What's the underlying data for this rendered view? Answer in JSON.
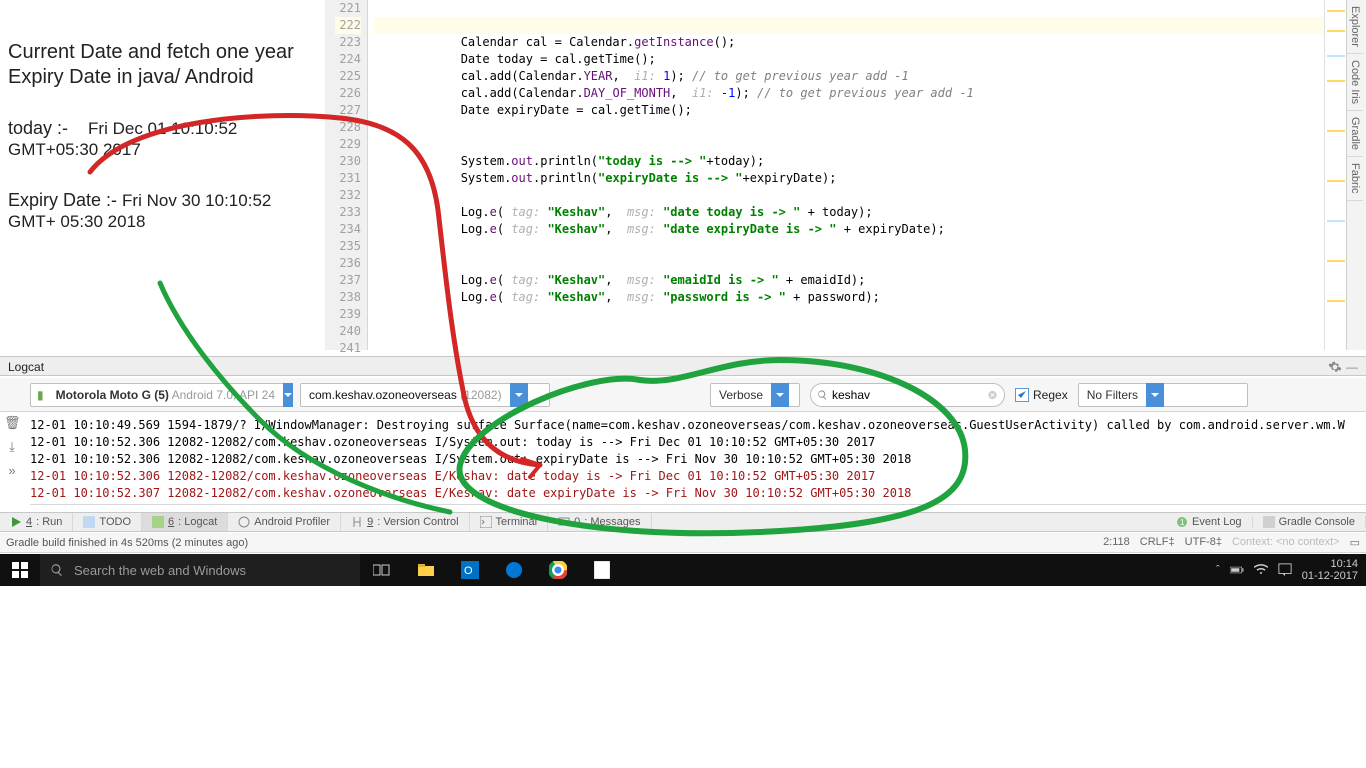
{
  "annotation": {
    "title": "Current Date and fetch one year Expiry Date in java/ Android",
    "today_label": "today :-",
    "today_value": "Fri Dec 01 10:10:52 GMT+05:30 2017",
    "expiry_label": "Expiry Date :- ",
    "expiry_value": "Fri Nov 30 10:10:52 GMT+ 05:30 2018"
  },
  "editor": {
    "first_line": 221,
    "highlight_line": 222,
    "lines": {
      "221": "",
      "222": "",
      "223": {
        "indent": "            ",
        "raw": "Calendar cal = Calendar.getInstance();",
        "segments": [
          {
            "t": "Calendar cal = Calendar",
            "c": "ident"
          },
          {
            "t": ".",
            "c": "dot"
          },
          {
            "t": "getInstance",
            "c": "field"
          },
          {
            "t": "();",
            "c": "ident"
          }
        ]
      },
      "224": {
        "indent": "            ",
        "raw": "Date today = cal.getTime();",
        "segments": [
          {
            "t": "Date today = cal",
            "c": "ident"
          },
          {
            "t": ".",
            "c": "dot"
          },
          {
            "t": "getTime",
            "c": "ident"
          },
          {
            "t": "();",
            "c": "ident"
          }
        ]
      },
      "225": {
        "indent": "            ",
        "raw": "cal.add(Calendar.YEAR,  i1: 1); // to get previous year add -1",
        "segments": [
          {
            "t": "cal",
            "c": "ident"
          },
          {
            "t": ".",
            "c": "dot"
          },
          {
            "t": "add",
            "c": "ident"
          },
          {
            "t": "(Calendar",
            "c": "ident"
          },
          {
            "t": ".",
            "c": "dot"
          },
          {
            "t": "YEAR",
            "c": "field"
          },
          {
            "t": ",  ",
            "c": "ident"
          },
          {
            "t": "i1:",
            "c": "hint"
          },
          {
            "t": " ",
            "c": "ident"
          },
          {
            "t": "1",
            "c": "num"
          },
          {
            "t": "); ",
            "c": "ident"
          },
          {
            "t": "// to get previous year add -1",
            "c": "cmt"
          }
        ]
      },
      "226": {
        "indent": "            ",
        "raw": "cal.add(Calendar.DAY_OF_MONTH,  i1: -1); // to get previous year add -1",
        "segments": [
          {
            "t": "cal",
            "c": "ident"
          },
          {
            "t": ".",
            "c": "dot"
          },
          {
            "t": "add",
            "c": "ident"
          },
          {
            "t": "(Calendar",
            "c": "ident"
          },
          {
            "t": ".",
            "c": "dot"
          },
          {
            "t": "DAY_OF_MONTH",
            "c": "field"
          },
          {
            "t": ",  ",
            "c": "ident"
          },
          {
            "t": "i1:",
            "c": "hint"
          },
          {
            "t": " ",
            "c": "ident"
          },
          {
            "t": "-1",
            "c": "num"
          },
          {
            "t": "); ",
            "c": "ident"
          },
          {
            "t": "// to get previous year add -1",
            "c": "cmt"
          }
        ]
      },
      "227": {
        "indent": "            ",
        "raw": "Date expiryDate = cal.getTime();",
        "segments": [
          {
            "t": "Date expiryDate = cal",
            "c": "ident"
          },
          {
            "t": ".",
            "c": "dot"
          },
          {
            "t": "getTime",
            "c": "ident"
          },
          {
            "t": "();",
            "c": "ident"
          }
        ]
      },
      "228": "",
      "229": "",
      "230": {
        "indent": "            ",
        "raw": "System.out.println(\"today is --> \"+today);",
        "segments": [
          {
            "t": "System",
            "c": "ident"
          },
          {
            "t": ".",
            "c": "dot"
          },
          {
            "t": "out",
            "c": "field"
          },
          {
            "t": ".",
            "c": "dot"
          },
          {
            "t": "println",
            "c": "ident"
          },
          {
            "t": "(",
            "c": "ident"
          },
          {
            "t": "\"today is --> \"",
            "c": "str"
          },
          {
            "t": "+today);",
            "c": "ident"
          }
        ]
      },
      "231": {
        "indent": "            ",
        "raw": "System.out.println(\"expiryDate is --> \"+expiryDate);",
        "segments": [
          {
            "t": "System",
            "c": "ident"
          },
          {
            "t": ".",
            "c": "dot"
          },
          {
            "t": "out",
            "c": "field"
          },
          {
            "t": ".",
            "c": "dot"
          },
          {
            "t": "println",
            "c": "ident"
          },
          {
            "t": "(",
            "c": "ident"
          },
          {
            "t": "\"expiryDate is --> \"",
            "c": "str"
          },
          {
            "t": "+expiryDate);",
            "c": "ident"
          }
        ]
      },
      "232": "",
      "233": {
        "indent": "            ",
        "raw": "Log.e( tag: \"Keshav\",  msg: \"date today is -> \" + today);",
        "segments": [
          {
            "t": "Log",
            "c": "ident"
          },
          {
            "t": ".",
            "c": "dot"
          },
          {
            "t": "e",
            "c": "field"
          },
          {
            "t": "( ",
            "c": "ident"
          },
          {
            "t": "tag:",
            "c": "hint"
          },
          {
            "t": " ",
            "c": "ident"
          },
          {
            "t": "\"Keshav\"",
            "c": "str"
          },
          {
            "t": ",  ",
            "c": "ident"
          },
          {
            "t": "msg:",
            "c": "hint"
          },
          {
            "t": " ",
            "c": "ident"
          },
          {
            "t": "\"date today is -> \"",
            "c": "str"
          },
          {
            "t": " + today);",
            "c": "ident"
          }
        ]
      },
      "234": {
        "indent": "            ",
        "raw": "Log.e( tag: \"Keshav\",  msg: \"date expiryDate is -> \" + expiryDate);",
        "segments": [
          {
            "t": "Log",
            "c": "ident"
          },
          {
            "t": ".",
            "c": "dot"
          },
          {
            "t": "e",
            "c": "field"
          },
          {
            "t": "( ",
            "c": "ident"
          },
          {
            "t": "tag:",
            "c": "hint"
          },
          {
            "t": " ",
            "c": "ident"
          },
          {
            "t": "\"Keshav\"",
            "c": "str"
          },
          {
            "t": ",  ",
            "c": "ident"
          },
          {
            "t": "msg:",
            "c": "hint"
          },
          {
            "t": " ",
            "c": "ident"
          },
          {
            "t": "\"date expiryDate is -> \"",
            "c": "str"
          },
          {
            "t": " + expiryDate);",
            "c": "ident"
          }
        ]
      },
      "235": "",
      "236": "",
      "237": {
        "indent": "            ",
        "raw": "Log.e( tag: \"Keshav\",  msg: \"emaidId is -> \" + emaidId);",
        "segments": [
          {
            "t": "Log",
            "c": "ident"
          },
          {
            "t": ".",
            "c": "dot"
          },
          {
            "t": "e",
            "c": "field"
          },
          {
            "t": "( ",
            "c": "ident"
          },
          {
            "t": "tag:",
            "c": "hint"
          },
          {
            "t": " ",
            "c": "ident"
          },
          {
            "t": "\"Keshav\"",
            "c": "str"
          },
          {
            "t": ",  ",
            "c": "ident"
          },
          {
            "t": "msg:",
            "c": "hint"
          },
          {
            "t": " ",
            "c": "ident"
          },
          {
            "t": "\"emaidId is -> \"",
            "c": "str"
          },
          {
            "t": " + emaidId);",
            "c": "ident"
          }
        ]
      },
      "238": {
        "indent": "            ",
        "raw": "Log.e( tag: \"Keshav\",  msg: \"password is -> \" + password);",
        "segments": [
          {
            "t": "Log",
            "c": "ident"
          },
          {
            "t": ".",
            "c": "dot"
          },
          {
            "t": "e",
            "c": "field"
          },
          {
            "t": "( ",
            "c": "ident"
          },
          {
            "t": "tag:",
            "c": "hint"
          },
          {
            "t": " ",
            "c": "ident"
          },
          {
            "t": "\"Keshav\"",
            "c": "str"
          },
          {
            "t": ",  ",
            "c": "ident"
          },
          {
            "t": "msg:",
            "c": "hint"
          },
          {
            "t": " ",
            "c": "ident"
          },
          {
            "t": "\"password is -> \"",
            "c": "str"
          },
          {
            "t": " + password);",
            "c": "ident"
          }
        ]
      },
      "239": "",
      "240": "",
      "241": ""
    }
  },
  "right_tools": [
    "Explorer",
    "Code Iris",
    "Gradle",
    "Fabric"
  ],
  "logcat": {
    "tab_title": "Logcat",
    "device": {
      "name": "Motorola Moto G (5)",
      "extra": "Android 7.0, API 24"
    },
    "app": {
      "name": "com.keshav.ozoneoverseas",
      "extra": "(12082)"
    },
    "level": "Verbose",
    "search": "keshav",
    "regex_label": "Regex",
    "regex_checked": true,
    "filter": "No Filters",
    "lines": [
      {
        "lvl": "i",
        "t": "12-01 10:10:49.569 1594-1879/? I/WindowManager: Destroying surface Surface(name=com.keshav.ozoneoverseas/com.keshav.ozoneoverseas.GuestUserActivity) called by com.android.server.wm.W"
      },
      {
        "lvl": "i",
        "t": "12-01 10:10:52.306 12082-12082/com.keshav.ozoneoverseas I/System.out: today is --> Fri Dec 01 10:10:52 GMT+05:30 2017"
      },
      {
        "lvl": "i",
        "t": "12-01 10:10:52.306 12082-12082/com.keshav.ozoneoverseas I/System.out: expiryDate is --> Fri Nov 30 10:10:52 GMT+05:30 2018"
      },
      {
        "lvl": "e",
        "t": "12-01 10:10:52.306 12082-12082/com.keshav.ozoneoverseas E/Keshav: date today is -> Fri Dec 01 10:10:52 GMT+05:30 2017"
      },
      {
        "lvl": "e",
        "t": "12-01 10:10:52.307 12082-12082/com.keshav.ozoneoverseas E/Keshav: date expiryDate is -> Fri Nov 30 10:10:52 GMT+05:30 2018"
      }
    ]
  },
  "bottom_bar": {
    "items": [
      {
        "u": "4",
        "label": ": Run",
        "icon": "play"
      },
      {
        "u": "",
        "label": "TODO",
        "icon": "todo"
      },
      {
        "u": "6",
        "label": ": Logcat",
        "icon": "logcat",
        "active": true
      },
      {
        "u": "",
        "label": "Android Profiler",
        "icon": "profiler"
      },
      {
        "u": "9",
        "label": ": Version Control",
        "icon": "vcs"
      },
      {
        "u": "",
        "label": "Terminal",
        "icon": "terminal"
      },
      {
        "u": "0",
        "label": ": Messages",
        "icon": "msg"
      }
    ],
    "right": [
      {
        "label": "Event Log",
        "icon": "event"
      },
      {
        "label": "Gradle Console",
        "icon": "gradle"
      }
    ]
  },
  "status": {
    "msg": "Gradle build finished in 4s 520ms (2 minutes ago)",
    "pos": "2:118",
    "eol": "CRLF",
    "enc": "UTF-8",
    "ctx_label": "Context:",
    "ctx_val": "<no context>"
  },
  "taskbar": {
    "search_placeholder": "Search the web and Windows",
    "clock_time": "10:14",
    "clock_date": "01-12-2017"
  }
}
